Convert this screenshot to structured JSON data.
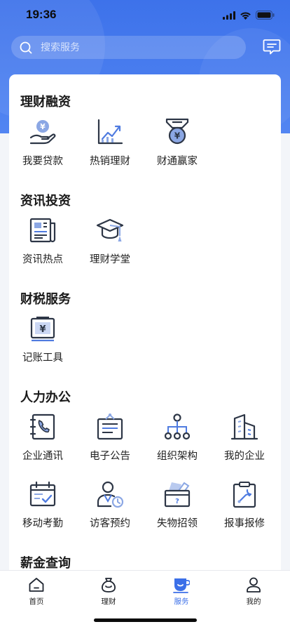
{
  "status": {
    "time": "19:36"
  },
  "search": {
    "placeholder": "搜索服务"
  },
  "sections": [
    {
      "title": "理财融资",
      "items": [
        "我要贷款",
        "热销理财",
        "财通赢家"
      ]
    },
    {
      "title": "资讯投资",
      "items": [
        "资讯热点",
        "理财学堂"
      ]
    },
    {
      "title": "财税服务",
      "items": [
        "记账工具"
      ]
    },
    {
      "title": "人力办公",
      "items": [
        "企业通讯",
        "电子公告",
        "组织架构",
        "我的企业",
        "移动考勤",
        "访客预约",
        "失物招领",
        "报事报修"
      ]
    },
    {
      "title": "薪金查询",
      "items": []
    }
  ],
  "tabs": [
    "首页",
    "理财",
    "服务",
    "我的"
  ],
  "active_tab": "服务",
  "colors": {
    "primary": "#3b6fe8",
    "icon_dark": "#2d3646",
    "icon_blue": "#4f7be0",
    "hero": "#3d72ea"
  }
}
